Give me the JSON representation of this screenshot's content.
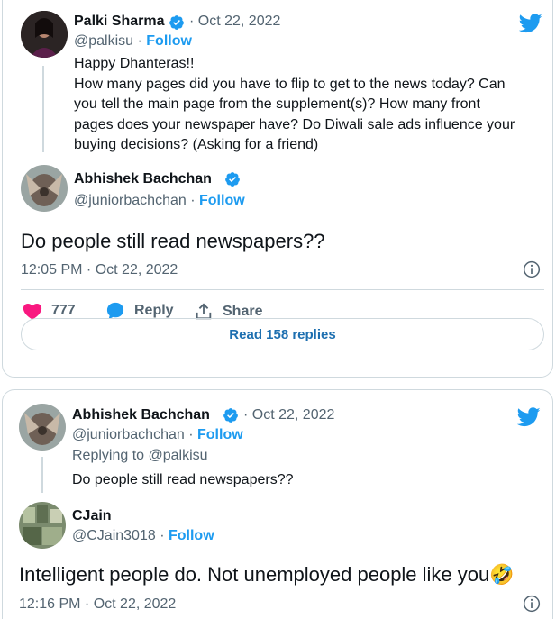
{
  "parent_tweet": {
    "author_name": "Palki Sharma",
    "handle": "@palkisu",
    "separator": "·",
    "follow_label": "Follow",
    "date": "Oct 22, 2022",
    "lines": [
      "Happy Dhanteras!!",
      "How many pages did you have to flip to get to the news today? Can",
      "you tell the main page from the supplement(s)? How many front",
      "pages does your newspaper have?  Do Diwali sale ads influence your",
      "buying decisions? (Asking for a friend)"
    ]
  },
  "main_tweet": {
    "author_name": "Abhishek Bachchan",
    "handle": "@juniorbachchan",
    "separator": "·",
    "follow_label": "Follow",
    "text": "Do people still read newspapers??",
    "timestamp": "12:05 PM · Oct 22, 2022",
    "likes": "777",
    "reply_label": "Reply",
    "share_label": "Share",
    "read_replies_label": "Read 158 replies"
  },
  "reply_card": {
    "parent": {
      "author_name": "Abhishek Bachchan",
      "date": "· Oct 22, 2022",
      "handle": "@juniorbachchan",
      "separator": "·",
      "follow_label": "Follow",
      "replying_to_prefix": "Replying to ",
      "replying_to_handle": "@palkisu",
      "text": "Do people still read newspapers??"
    },
    "reply": {
      "author_name": "CJain",
      "handle": "@CJain3018",
      "separator": "·",
      "follow_label": "Follow",
      "text": "Intelligent people do. Not unemployed people like you",
      "emoji": "🤣",
      "timestamp": "12:16 PM · Oct 22, 2022"
    }
  },
  "colors": {
    "accent": "#1d9bf0",
    "like": "#f91880",
    "border": "#cfd9de",
    "muted": "#536471"
  },
  "icons": [
    "twitter-bird-icon",
    "verified-badge-icon",
    "heart-icon",
    "reply-bubble-icon",
    "share-icon",
    "info-icon"
  ]
}
